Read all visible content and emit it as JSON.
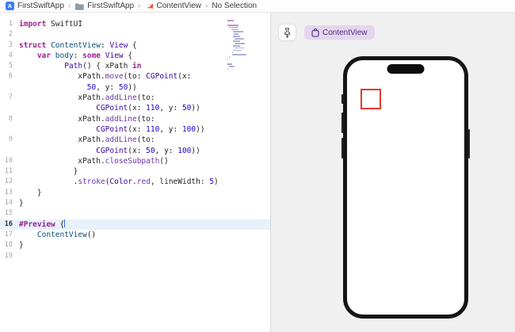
{
  "breadcrumb": {
    "separator": "›",
    "items": [
      {
        "icon": "app-icon",
        "label": "FirstSwiftApp"
      },
      {
        "icon": "folder-icon",
        "label": "FirstSwiftApp"
      },
      {
        "icon": "swift-icon",
        "label": "ContentView"
      },
      {
        "icon": null,
        "label": "No Selection"
      }
    ]
  },
  "editor": {
    "current_row": 19,
    "rows": [
      {
        "n": "1",
        "s": [
          {
            "t": "import",
            "c": "k"
          },
          {
            "t": " SwiftUI",
            "c": "pl"
          }
        ]
      },
      {
        "n": "2",
        "s": []
      },
      {
        "n": "3",
        "s": [
          {
            "t": "struct",
            "c": "k"
          },
          {
            "t": " ",
            "c": "pl"
          },
          {
            "t": "ContentView",
            "c": "pr"
          },
          {
            "t": ": ",
            "c": "pl"
          },
          {
            "t": "View",
            "c": "ty"
          },
          {
            "t": " {",
            "c": "pl"
          }
        ]
      },
      {
        "n": "4",
        "s": [
          {
            "t": "    ",
            "c": "pl"
          },
          {
            "t": "var",
            "c": "k"
          },
          {
            "t": " ",
            "c": "pl"
          },
          {
            "t": "body",
            "c": "pr"
          },
          {
            "t": ": ",
            "c": "pl"
          },
          {
            "t": "some",
            "c": "k"
          },
          {
            "t": " ",
            "c": "pl"
          },
          {
            "t": "View",
            "c": "ty"
          },
          {
            "t": " {",
            "c": "pl"
          }
        ]
      },
      {
        "n": "5",
        "s": [
          {
            "t": "          ",
            "c": "pl"
          },
          {
            "t": "Path",
            "c": "ty"
          },
          {
            "t": "() { xPath ",
            "c": "pl"
          },
          {
            "t": "in",
            "c": "k"
          }
        ]
      },
      {
        "n": "6",
        "s": [
          {
            "t": "             xPath.",
            "c": "pl"
          },
          {
            "t": "move",
            "c": "me"
          },
          {
            "t": "(to: ",
            "c": "pl"
          },
          {
            "t": "CGPoint",
            "c": "ty"
          },
          {
            "t": "(x:",
            "c": "pl"
          }
        ]
      },
      {
        "n": "",
        "s": [
          {
            "t": "               ",
            "c": "pl"
          },
          {
            "t": "50",
            "c": "nu"
          },
          {
            "t": ", y: ",
            "c": "pl"
          },
          {
            "t": "50",
            "c": "nu"
          },
          {
            "t": "))",
            "c": "pl"
          }
        ]
      },
      {
        "n": "7",
        "s": [
          {
            "t": "             xPath.",
            "c": "pl"
          },
          {
            "t": "addLine",
            "c": "me"
          },
          {
            "t": "(to:",
            "c": "pl"
          }
        ]
      },
      {
        "n": "",
        "s": [
          {
            "t": "                 ",
            "c": "pl"
          },
          {
            "t": "CGPoint",
            "c": "ty"
          },
          {
            "t": "(x: ",
            "c": "pl"
          },
          {
            "t": "110",
            "c": "nu"
          },
          {
            "t": ", y: ",
            "c": "pl"
          },
          {
            "t": "50",
            "c": "nu"
          },
          {
            "t": "))",
            "c": "pl"
          }
        ]
      },
      {
        "n": "8",
        "s": [
          {
            "t": "             xPath.",
            "c": "pl"
          },
          {
            "t": "addLine",
            "c": "me"
          },
          {
            "t": "(to:",
            "c": "pl"
          }
        ]
      },
      {
        "n": "",
        "s": [
          {
            "t": "                 ",
            "c": "pl"
          },
          {
            "t": "CGPoint",
            "c": "ty"
          },
          {
            "t": "(x: ",
            "c": "pl"
          },
          {
            "t": "110",
            "c": "nu"
          },
          {
            "t": ", y: ",
            "c": "pl"
          },
          {
            "t": "100",
            "c": "nu"
          },
          {
            "t": "))",
            "c": "pl"
          }
        ]
      },
      {
        "n": "9",
        "s": [
          {
            "t": "             xPath.",
            "c": "pl"
          },
          {
            "t": "addLine",
            "c": "me"
          },
          {
            "t": "(to:",
            "c": "pl"
          }
        ]
      },
      {
        "n": "",
        "s": [
          {
            "t": "                 ",
            "c": "pl"
          },
          {
            "t": "CGPoint",
            "c": "ty"
          },
          {
            "t": "(x: ",
            "c": "pl"
          },
          {
            "t": "50",
            "c": "nu"
          },
          {
            "t": ", y: ",
            "c": "pl"
          },
          {
            "t": "100",
            "c": "nu"
          },
          {
            "t": "))",
            "c": "pl"
          }
        ]
      },
      {
        "n": "10",
        "s": [
          {
            "t": "             xPath.",
            "c": "pl"
          },
          {
            "t": "closeSubpath",
            "c": "me"
          },
          {
            "t": "()",
            "c": "pl"
          }
        ]
      },
      {
        "n": "11",
        "s": [
          {
            "t": "            }",
            "c": "pl"
          }
        ]
      },
      {
        "n": "12",
        "s": [
          {
            "t": "            .",
            "c": "pl"
          },
          {
            "t": "stroke",
            "c": "me"
          },
          {
            "t": "(",
            "c": "pl"
          },
          {
            "t": "Color",
            "c": "ty"
          },
          {
            "t": ".",
            "c": "pl"
          },
          {
            "t": "red",
            "c": "me"
          },
          {
            "t": ", lineWidth: ",
            "c": "pl"
          },
          {
            "t": "5",
            "c": "nu"
          },
          {
            "t": ")",
            "c": "pl"
          }
        ]
      },
      {
        "n": "13",
        "s": [
          {
            "t": "    }",
            "c": "pl"
          }
        ]
      },
      {
        "n": "14",
        "s": [
          {
            "t": "}",
            "c": "pl"
          }
        ]
      },
      {
        "n": "15",
        "s": []
      },
      {
        "n": "16",
        "s": [
          {
            "t": "#Preview",
            "c": "k"
          },
          {
            "t": " {",
            "c": "pl"
          }
        ],
        "cursor": true
      },
      {
        "n": "17",
        "s": [
          {
            "t": "    ",
            "c": "pl"
          },
          {
            "t": "ContentView",
            "c": "pr"
          },
          {
            "t": "()",
            "c": "pl"
          }
        ]
      },
      {
        "n": "18",
        "s": [
          {
            "t": "}",
            "c": "pl"
          }
        ]
      },
      {
        "n": "19",
        "s": []
      }
    ]
  },
  "preview": {
    "pin_icon": "pin-icon",
    "tab_icon": "app-preview-icon",
    "tab_label": "ContentView",
    "device": "iphone",
    "shape": {
      "name": "red-square-outline",
      "stroke_color": "#e13b30",
      "line_width": 5
    }
  },
  "colors": {
    "keyword": "#9b2393",
    "framework_type": "#3900a0",
    "framework_member": "#6c36a9",
    "project_symbol": "#0b4f79",
    "number_literal": "#1c00cf",
    "current_line_bg": "#e8f2fc",
    "pill_bg": "#e6d5ef",
    "pill_text": "#4f2d7f",
    "canvas_bg": "#f0f0f1",
    "swift_orange": "#f05138",
    "app_icon_blue": "#3e7bf2",
    "shape_red": "#e13b30"
  }
}
